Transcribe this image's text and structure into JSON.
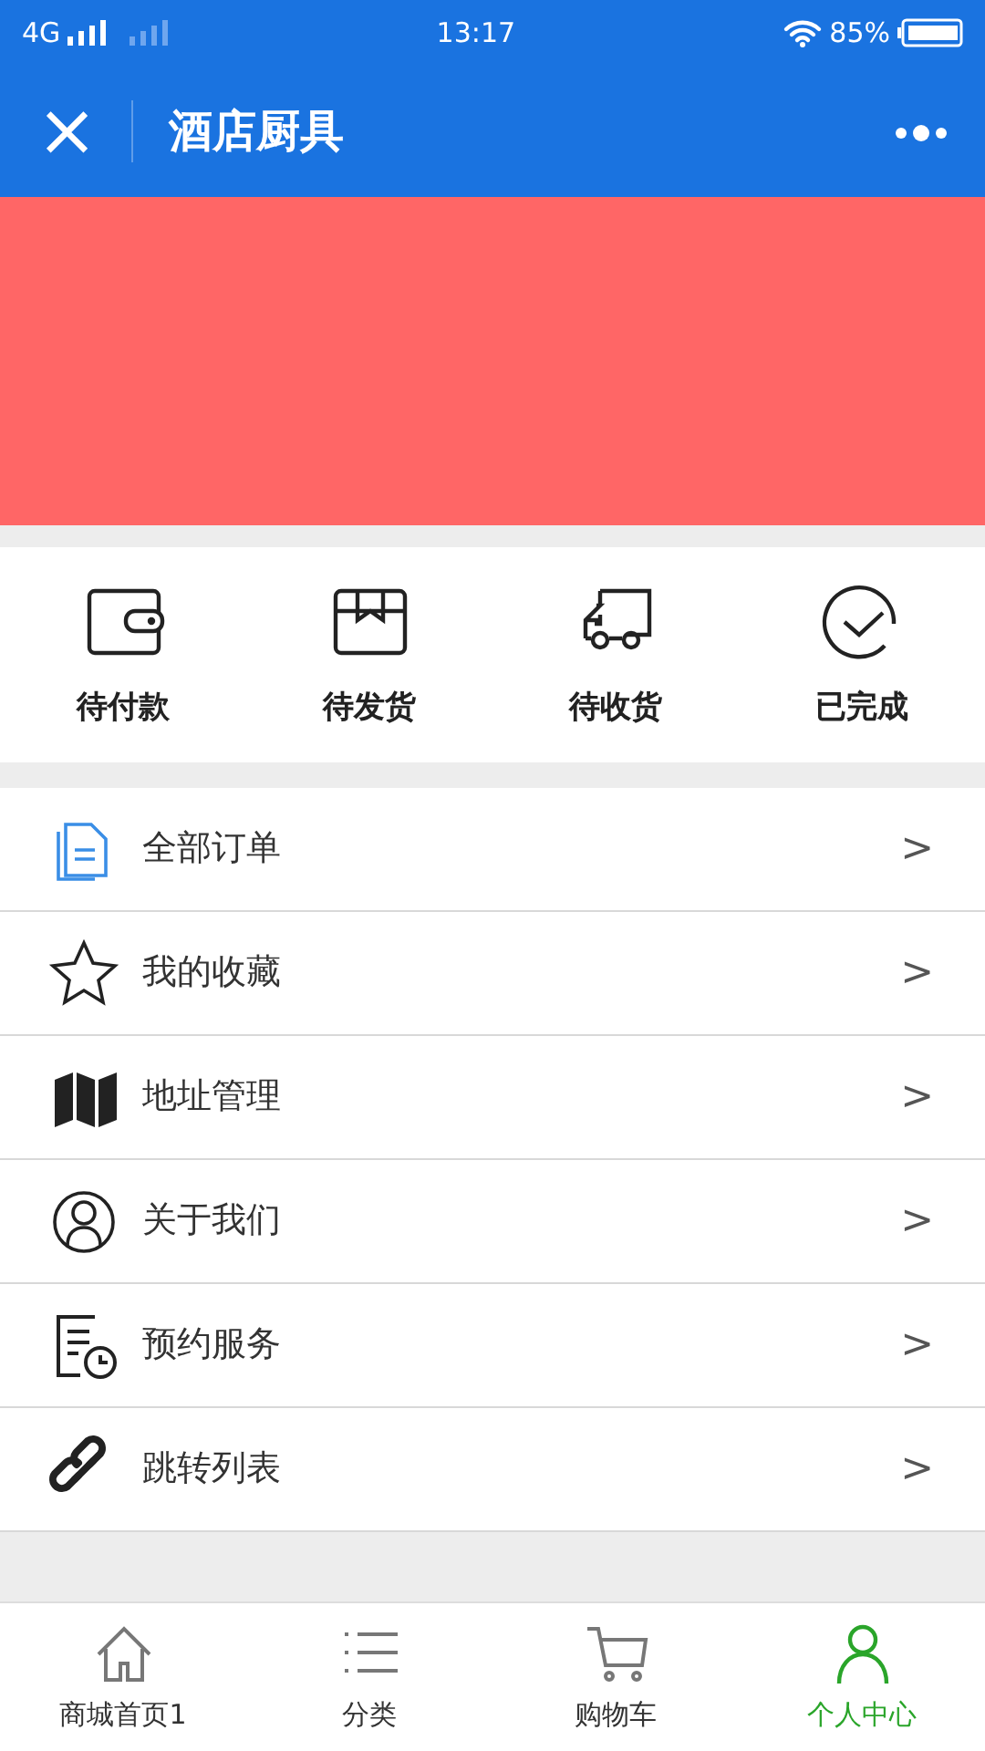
{
  "status_bar": {
    "network": "4G",
    "time": "13:17",
    "battery": "85%"
  },
  "nav": {
    "close": "×",
    "title": "酒店厨具"
  },
  "orders": [
    {
      "kind": "wallet",
      "label": "待付款"
    },
    {
      "kind": "box",
      "label": "待发货"
    },
    {
      "kind": "truck",
      "label": "待收货"
    },
    {
      "kind": "check",
      "label": "已完成"
    }
  ],
  "menu": [
    {
      "kind": "doc",
      "label": "全部订单",
      "arrow": ">"
    },
    {
      "kind": "star",
      "label": "我的收藏",
      "arrow": ">"
    },
    {
      "kind": "map",
      "label": "地址管理",
      "arrow": ">"
    },
    {
      "kind": "user",
      "label": "关于我们",
      "arrow": ">"
    },
    {
      "kind": "clock",
      "label": "预约服务",
      "arrow": ">"
    },
    {
      "kind": "link",
      "label": "跳转列表",
      "arrow": ">"
    }
  ],
  "tab_bar": [
    {
      "kind": "home",
      "label": "商城首页1",
      "selected": false
    },
    {
      "kind": "list",
      "label": "分类",
      "selected": false
    },
    {
      "kind": "cart",
      "label": "购物车",
      "selected": false
    },
    {
      "kind": "person",
      "label": "个人中心",
      "selected": true
    }
  ]
}
